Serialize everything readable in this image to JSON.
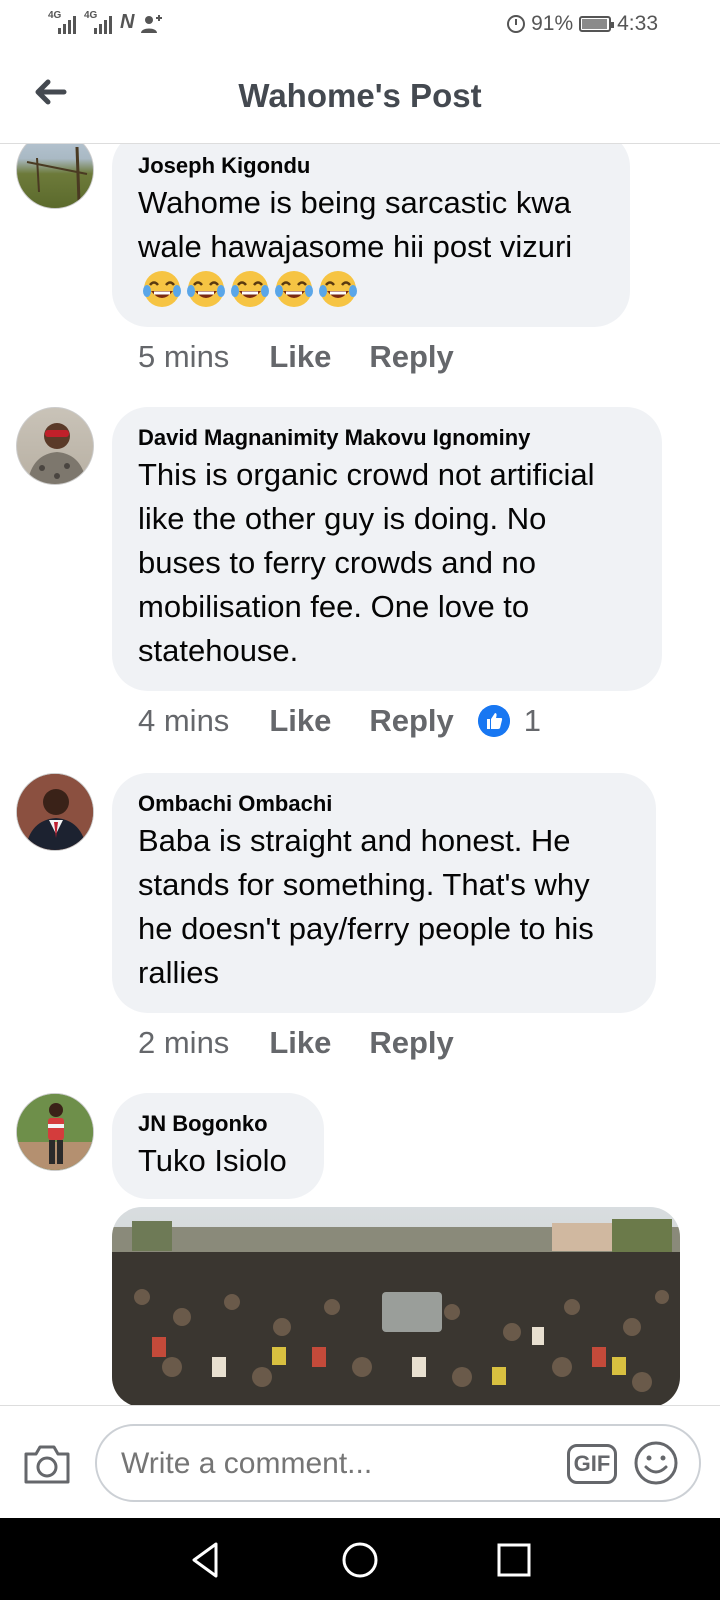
{
  "status_bar": {
    "signal1": "4G",
    "signal2": "4G",
    "battery": "91%",
    "time": "4:33"
  },
  "header": {
    "title": "Wahome's Post"
  },
  "comments": [
    {
      "author": "Joseph Kigondu",
      "text": "Wahome is being sarcastic kwa wale hawajasome hii post vizuri",
      "emojis": [
        "face-with-tears-of-joy",
        "face-with-tears-of-joy",
        "face-with-tears-of-joy",
        "face-with-tears-of-joy",
        "face-with-tears-of-joy"
      ],
      "time": "5 mins",
      "like_label": "Like",
      "reply_label": "Reply"
    },
    {
      "author": "David Magnanimity Makovu Ignominy",
      "text": "This is organic crowd not artificial like the other guy is doing. No buses to ferry crowds and no mobilisation fee. One love to statehouse.",
      "time": "4 mins",
      "like_label": "Like",
      "reply_label": "Reply",
      "reaction_count": "1"
    },
    {
      "author": "Ombachi Ombachi",
      "text": "Baba is straight and honest. He stands for something. That's why he doesn't pay/ferry people to his rallies",
      "time": "2 mins",
      "like_label": "Like",
      "reply_label": "Reply"
    },
    {
      "author": "JN Bogonko",
      "text": "Tuko Isiolo"
    }
  ],
  "composer": {
    "placeholder": "Write a comment...",
    "gif_label": "GIF"
  },
  "colors": {
    "bubble": "#f0f2f5",
    "meta_text": "#65676b",
    "accent": "#1877f2"
  }
}
